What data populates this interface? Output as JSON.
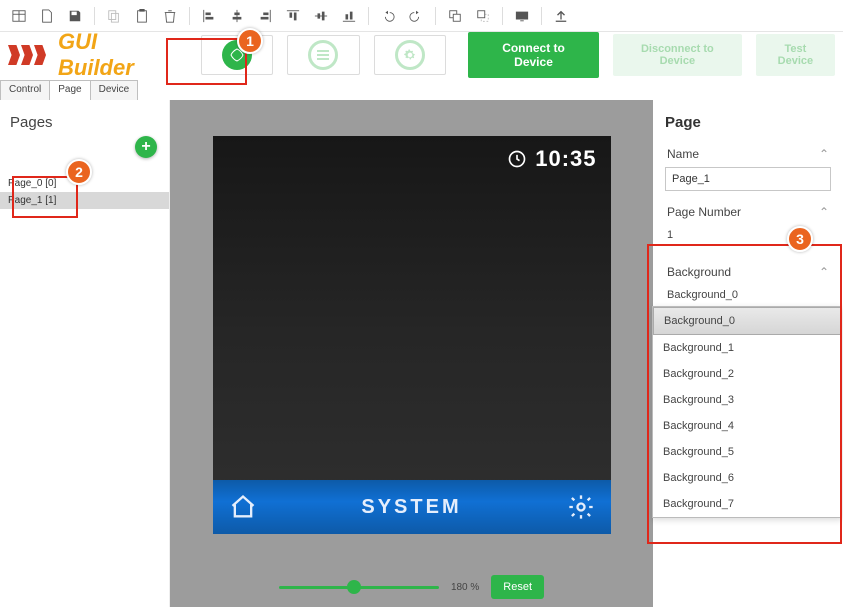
{
  "app_title": "GUI Builder",
  "toolbar": {
    "icons": [
      "table-icon",
      "file-icon",
      "save-icon",
      "copy-icon",
      "clipboard-icon",
      "trash-icon",
      "align-left-icon",
      "align-center-icon",
      "align-right-icon",
      "align-top-icon",
      "align-middle-icon",
      "align-bottom-icon",
      "undo-icon",
      "redo-icon",
      "bring-front-icon",
      "send-back-icon",
      "screen-icon",
      "upload-icon"
    ]
  },
  "device_buttons": {
    "connect": "Connect to Device",
    "disconnect": "Disconnect to Device",
    "test": "Test Device"
  },
  "tabs": [
    "Control",
    "Page",
    "Device"
  ],
  "active_tab": 1,
  "pages_panel": {
    "title": "Pages",
    "items": [
      "Page_0 [0]",
      "Page_1 [1]"
    ],
    "selected": 1,
    "add_label": "+"
  },
  "preview": {
    "clock": "10:35",
    "footer_title": "SYSTEM"
  },
  "zoom": {
    "percent": "180 %",
    "reset": "Reset"
  },
  "props": {
    "title": "Page",
    "name_label": "Name",
    "name_value": "Page_1",
    "number_label": "Page Number",
    "number_value": "1",
    "background_label": "Background",
    "background_value": "Background_0",
    "background_options": [
      "Background_0",
      "Background_1",
      "Background_2",
      "Background_3",
      "Background_4",
      "Background_5",
      "Background_6",
      "Background_7"
    ]
  },
  "callouts": {
    "one": "1",
    "two": "2",
    "three": "3"
  }
}
